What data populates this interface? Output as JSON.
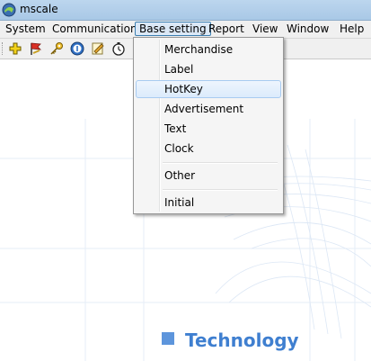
{
  "window": {
    "title": "mscale"
  },
  "menubar": {
    "items": [
      {
        "label": "System"
      },
      {
        "label": "Communication"
      },
      {
        "label": "Base setting"
      },
      {
        "label": "Report"
      },
      {
        "label": "View"
      },
      {
        "label": "Window"
      },
      {
        "label": "Help"
      }
    ]
  },
  "toolbar": {
    "icons": [
      "add-icon",
      "flag-icon",
      "key-icon",
      "info-icon",
      "edit-icon",
      "stopwatch-icon"
    ]
  },
  "dropdown": {
    "items": [
      {
        "label": "Merchandise"
      },
      {
        "label": "Label"
      },
      {
        "label": "HotKey",
        "highlighted": true
      },
      {
        "label": "Advertisement"
      },
      {
        "label": "Text"
      },
      {
        "label": "Clock"
      },
      {
        "label": "Other"
      },
      {
        "label": "Initial"
      }
    ]
  },
  "background": {
    "label": "Technology"
  },
  "colors": {
    "accent": "#3f7fd0",
    "menu_active": "#dbe8f6",
    "titlebar": "#bcd6ee"
  }
}
